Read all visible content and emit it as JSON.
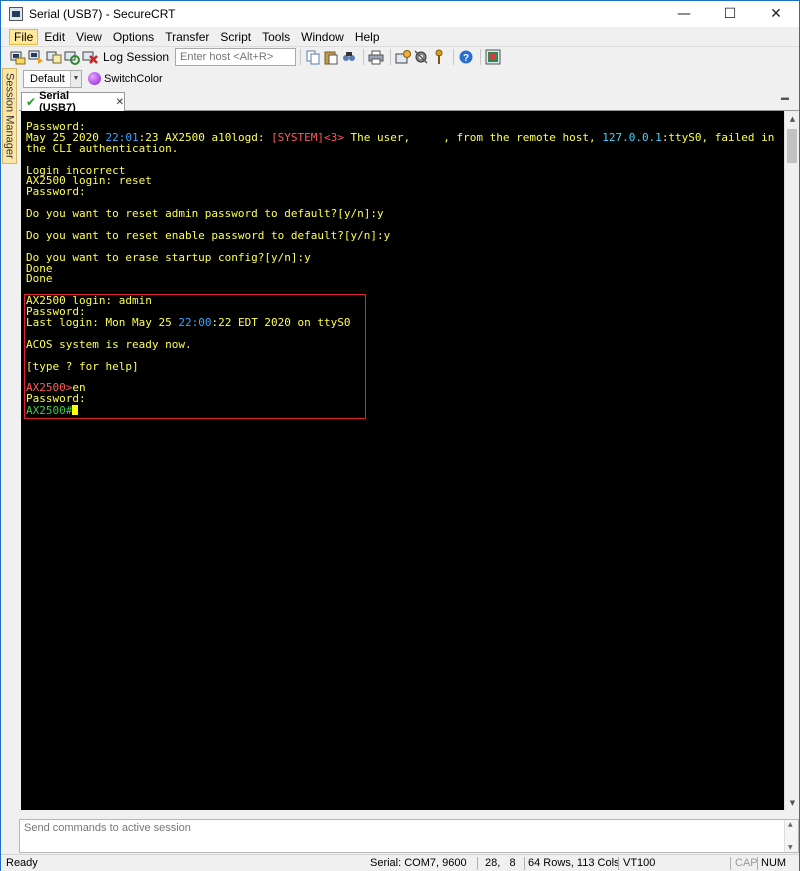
{
  "window": {
    "title": "Serial (USB7) - SecureCRT",
    "minimize": "—",
    "maximize": "☐",
    "close": "✕"
  },
  "menu": {
    "items": [
      "File",
      "Edit",
      "View",
      "Options",
      "Transfer",
      "Script",
      "Tools",
      "Window",
      "Help"
    ]
  },
  "toolbar": {
    "log_session": "Log Session",
    "host_placeholder": "Enter host <Alt+R>"
  },
  "side_tab": {
    "label": "Session Manager"
  },
  "button_bar": {
    "selected": "Default",
    "switch_color": "SwitchColor"
  },
  "session_tab": {
    "label": "Serial (USB7)",
    "close": "✕"
  },
  "terminal": {
    "pre_lines": [
      [
        {
          "t": "Password:",
          "c": "yellow"
        }
      ],
      [
        {
          "t": "May 25 2020 ",
          "c": "yellow"
        },
        {
          "t": "22:01",
          "c": "blue"
        },
        {
          "t": ":23 AX2500 a10logd: ",
          "c": "yellow"
        },
        {
          "t": "[SYSTEM]<3>",
          "c": "red"
        },
        {
          "t": " The user,     , from the remote host, ",
          "c": "yellow"
        },
        {
          "t": "127.0.0.1",
          "c": "cyan"
        },
        {
          "t": ":ttyS0, failed in",
          "c": "yellow"
        }
      ],
      [
        {
          "t": "the CLI authentication.",
          "c": "yellow"
        }
      ],
      [],
      [
        {
          "t": "Login incorrect",
          "c": "yellow"
        }
      ],
      [
        {
          "t": "AX2500 login: reset",
          "c": "yellow"
        }
      ],
      [
        {
          "t": "Password:",
          "c": "yellow"
        }
      ],
      [],
      [
        {
          "t": "Do you want to reset admin password to default?[y/n]:y",
          "c": "yellow"
        }
      ],
      [],
      [
        {
          "t": "Do you want to reset enable password to default?[y/n]:y",
          "c": "yellow"
        }
      ],
      [],
      [
        {
          "t": "Do you want to erase startup config?[y/n]:y",
          "c": "yellow"
        }
      ],
      [
        {
          "t": "Done",
          "c": "yellow"
        }
      ],
      [
        {
          "t": "Done",
          "c": "yellow"
        }
      ],
      [],
      [
        {
          "t": "AX2500 login: admin",
          "c": "yellow"
        }
      ],
      [
        {
          "t": "Password:",
          "c": "yellow"
        }
      ],
      [
        {
          "t": "Last login: Mon May 25 ",
          "c": "yellow"
        },
        {
          "t": "22:00",
          "c": "blue"
        },
        {
          "t": ":22 EDT 2020 on ttyS0",
          "c": "yellow"
        }
      ],
      [],
      [
        {
          "t": "ACOS system is ready now.",
          "c": "yellow"
        }
      ],
      [],
      [
        {
          "t": "[type ? for help]",
          "c": "yellow"
        }
      ],
      [],
      [
        {
          "t": "AX2500>",
          "c": "red"
        },
        {
          "t": "en",
          "c": "yellow"
        }
      ],
      [
        {
          "t": "Password:",
          "c": "yellow"
        }
      ],
      [
        {
          "t": "AX2500#",
          "c": "green"
        },
        {
          "t": "",
          "c": "cursor"
        }
      ]
    ]
  },
  "command_window": {
    "placeholder": "Send commands to active session"
  },
  "status": {
    "ready": "Ready",
    "connection": "Serial: COM7, 9600",
    "cursor_pos": "28,   8",
    "size": "64 Rows, 113 Cols",
    "emulation": "VT100",
    "cap": "CAP",
    "num": "NUM"
  }
}
